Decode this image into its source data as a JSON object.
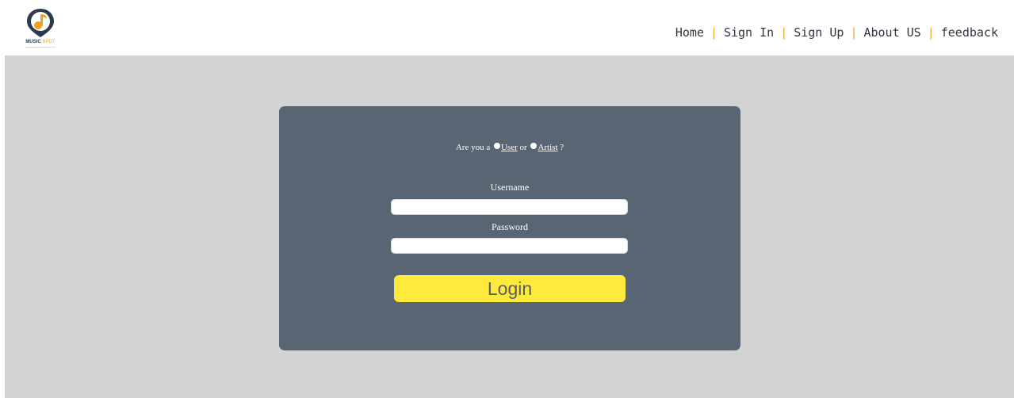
{
  "header": {
    "logo": {
      "icon": "music-pin-icon",
      "word1": "MUSIC",
      "word2": "SPOT"
    },
    "nav": [
      {
        "label": "Home"
      },
      {
        "label": "Sign In"
      },
      {
        "label": "Sign Up"
      },
      {
        "label": "About US"
      },
      {
        "label": "feedback"
      }
    ],
    "separator": "|"
  },
  "login": {
    "role_prompt": "Are you a",
    "role_user": "User",
    "role_or": "or",
    "role_artist": "Artist",
    "role_end": "?",
    "username_label": "Username",
    "username_value": "",
    "password_label": "Password",
    "password_value": "",
    "login_button": "Login"
  },
  "colors": {
    "background": "#d3d3d3",
    "card": "#586573",
    "button": "#ffe93a",
    "nav_separator": "#f0a528",
    "logo_orange": "#f2a01f",
    "logo_navy": "#2b3a4f"
  }
}
